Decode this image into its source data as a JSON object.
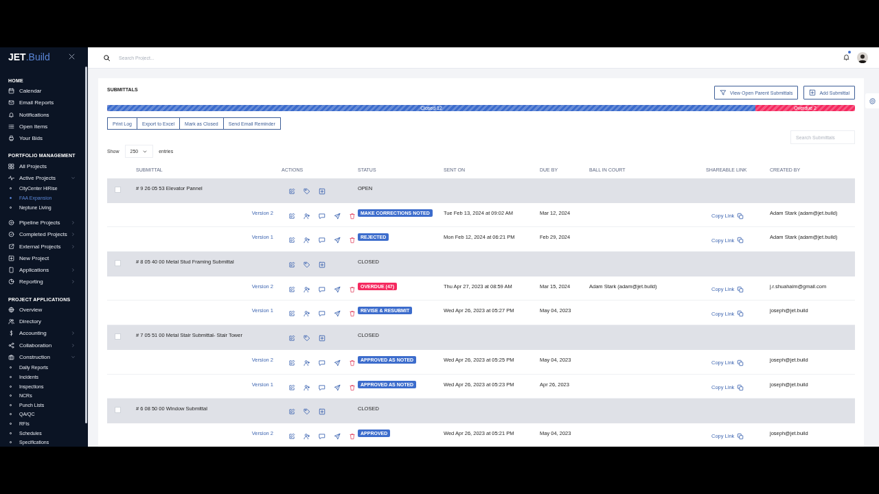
{
  "sidebar": {
    "logo": {
      "bold": "JET",
      "light": ".Build"
    },
    "sections": [
      {
        "title": "HOME",
        "items": [
          {
            "label": "Calendar",
            "selected": false
          },
          {
            "label": "Email Reports",
            "selected": false
          },
          {
            "label": "Notifications",
            "selected": false
          },
          {
            "label": "Open Items",
            "selected": false
          },
          {
            "label": "Your Bids",
            "selected": false
          }
        ]
      },
      {
        "title": "PORTFOLIO MANAGEMENT",
        "items": [
          {
            "label": "All Projects",
            "selected": false
          },
          {
            "label": "Active Projects",
            "selected": false,
            "expanded": true,
            "children": [
              {
                "label": "CityCenter HiRise",
                "selected": false
              },
              {
                "label": "FAA Expansion",
                "selected": true
              },
              {
                "label": "Neptune Living",
                "selected": false
              }
            ]
          },
          {
            "label": "Pipeline Projects",
            "selected": false,
            "expanded": false
          },
          {
            "label": "Completed Projects",
            "selected": false,
            "expanded": false
          },
          {
            "label": "External Projects",
            "selected": false,
            "expanded": false
          },
          {
            "label": "New Project",
            "selected": false
          },
          {
            "label": "Applications",
            "selected": false,
            "expanded": false
          },
          {
            "label": "Reporting",
            "selected": false,
            "expanded": false
          }
        ]
      },
      {
        "title": "PROJECT APPLICATIONS",
        "items": [
          {
            "label": "Overview",
            "selected": false
          },
          {
            "label": "Directory",
            "selected": false
          },
          {
            "label": "Accounting",
            "selected": false,
            "expanded": false
          },
          {
            "label": "Collaboration",
            "selected": false,
            "expanded": false
          },
          {
            "label": "Construction",
            "selected": false,
            "expanded": true,
            "children": [
              {
                "label": "Daily Reports",
                "selected": false
              },
              {
                "label": "Incidents",
                "selected": false
              },
              {
                "label": "Inspections",
                "selected": false
              },
              {
                "label": "NCRs",
                "selected": false
              },
              {
                "label": "Punch Lists",
                "selected": false
              },
              {
                "label": "QA/QC",
                "selected": false
              },
              {
                "label": "RFIs",
                "selected": false
              },
              {
                "label": "Schedules",
                "selected": false
              },
              {
                "label": "Specifications",
                "selected": false
              }
            ]
          }
        ]
      }
    ]
  },
  "topbar": {
    "search": {
      "placeholder": "Search Project..."
    },
    "notification_dot": true
  },
  "card": {
    "title": "SUBMITTALS",
    "header_buttons": [
      "View Open Parent Submittals",
      "Add Submittal"
    ],
    "progress": {
      "level": 0.867,
      "segments": [
        {
          "label": "Closed 12",
          "color": "#3c6ccc"
        },
        {
          "label": "Overdue 2",
          "color": "#f5295f"
        }
      ]
    },
    "toolbar_buttons": [
      "Print Log",
      "Export to Excel",
      "Mark as Closed",
      "Send Email Reminder"
    ],
    "search": {
      "placeholder": "Search Submittals"
    },
    "entries": {
      "before": "Show",
      "value": "250",
      "after": "entries"
    }
  },
  "table": {
    "columns": [
      "SUBMITTAL",
      "ACTIONS",
      "STATUS",
      "SENT ON",
      "DUE BY",
      "BALL IN COURT",
      "SHAREABLE LINK",
      "CREATED BY"
    ],
    "rows": [
      {
        "kind": "parent",
        "checked": false,
        "title": "# 9 26 05 53 Elevator Pannel",
        "status": "OPEN"
      },
      {
        "kind": "version",
        "version": "Version 2",
        "status": "MAKE CORRECTIONS NOTED",
        "color": "#3c6ccc",
        "sent_on": "Tue Feb 13, 2024 at 09:02 AM",
        "due_by": "Mar 12, 2024",
        "link": "Copy Link",
        "created_by": "Adam Stark (adam@jet.build)"
      },
      {
        "kind": "version",
        "version": "Version 1",
        "status": "REJECTED",
        "color": "#3c6ccc",
        "sent_on": "Mon Feb 12, 2024 at 06:21 PM",
        "due_by": "Feb 29, 2024",
        "link": "Copy Link",
        "created_by": "Adam Stark (adam@jet.build)"
      },
      {
        "kind": "parent",
        "checked": false,
        "title": "# 8 05 40 00 Metal Stud Framing Submittal",
        "status": "CLOSED"
      },
      {
        "kind": "version",
        "version": "Version 2",
        "status": "OVERDUE (47)",
        "color": "#f5295f",
        "sent_on": "Thu Apr 27, 2023 at 08:59 AM",
        "due_by": "Mar 15, 2024",
        "ball_in_court": "Adam Stark (adam@jet.build)",
        "link": "Copy Link",
        "created_by": "j.r.shuahaim@gmail.com"
      },
      {
        "kind": "version",
        "version": "Version 1",
        "status": "REVISE & RESUBMIT",
        "color": "#3c6ccc",
        "sent_on": "Wed Apr 26, 2023 at 05:27 PM",
        "due_by": "May 04, 2023",
        "link": "Copy Link",
        "created_by": "joseph@jet.build"
      },
      {
        "kind": "parent",
        "checked": false,
        "title": "# 7 05 51 00 Metal Stair Submittal- Stair Tower",
        "status": "CLOSED"
      },
      {
        "kind": "version",
        "version": "Version 2",
        "status": "APPROVED AS NOTED",
        "color": "#3c6ccc",
        "sent_on": "Wed Apr 26, 2023 at 05:25 PM",
        "due_by": "May 04, 2023",
        "link": "Copy Link",
        "created_by": "joseph@jet.build"
      },
      {
        "kind": "version",
        "version": "Version 1",
        "status": "APPROVED AS NOTED",
        "color": "#3c6ccc",
        "sent_on": "Wed Apr 26, 2023 at 05:23 PM",
        "due_by": "Apr 26, 2023",
        "link": "Copy Link",
        "created_by": "joseph@jet.build"
      },
      {
        "kind": "parent",
        "checked": false,
        "title": "# 6 08 50 00 Window Submittal",
        "status": "CLOSED"
      },
      {
        "kind": "version",
        "version": "Version 2",
        "status": "APPROVED",
        "color": "#3c6ccc",
        "sent_on": "Wed Apr 26, 2023 at 05:21 PM",
        "due_by": "May 04, 2023",
        "link": "Copy Link",
        "created_by": "joseph@jet.build"
      }
    ]
  }
}
